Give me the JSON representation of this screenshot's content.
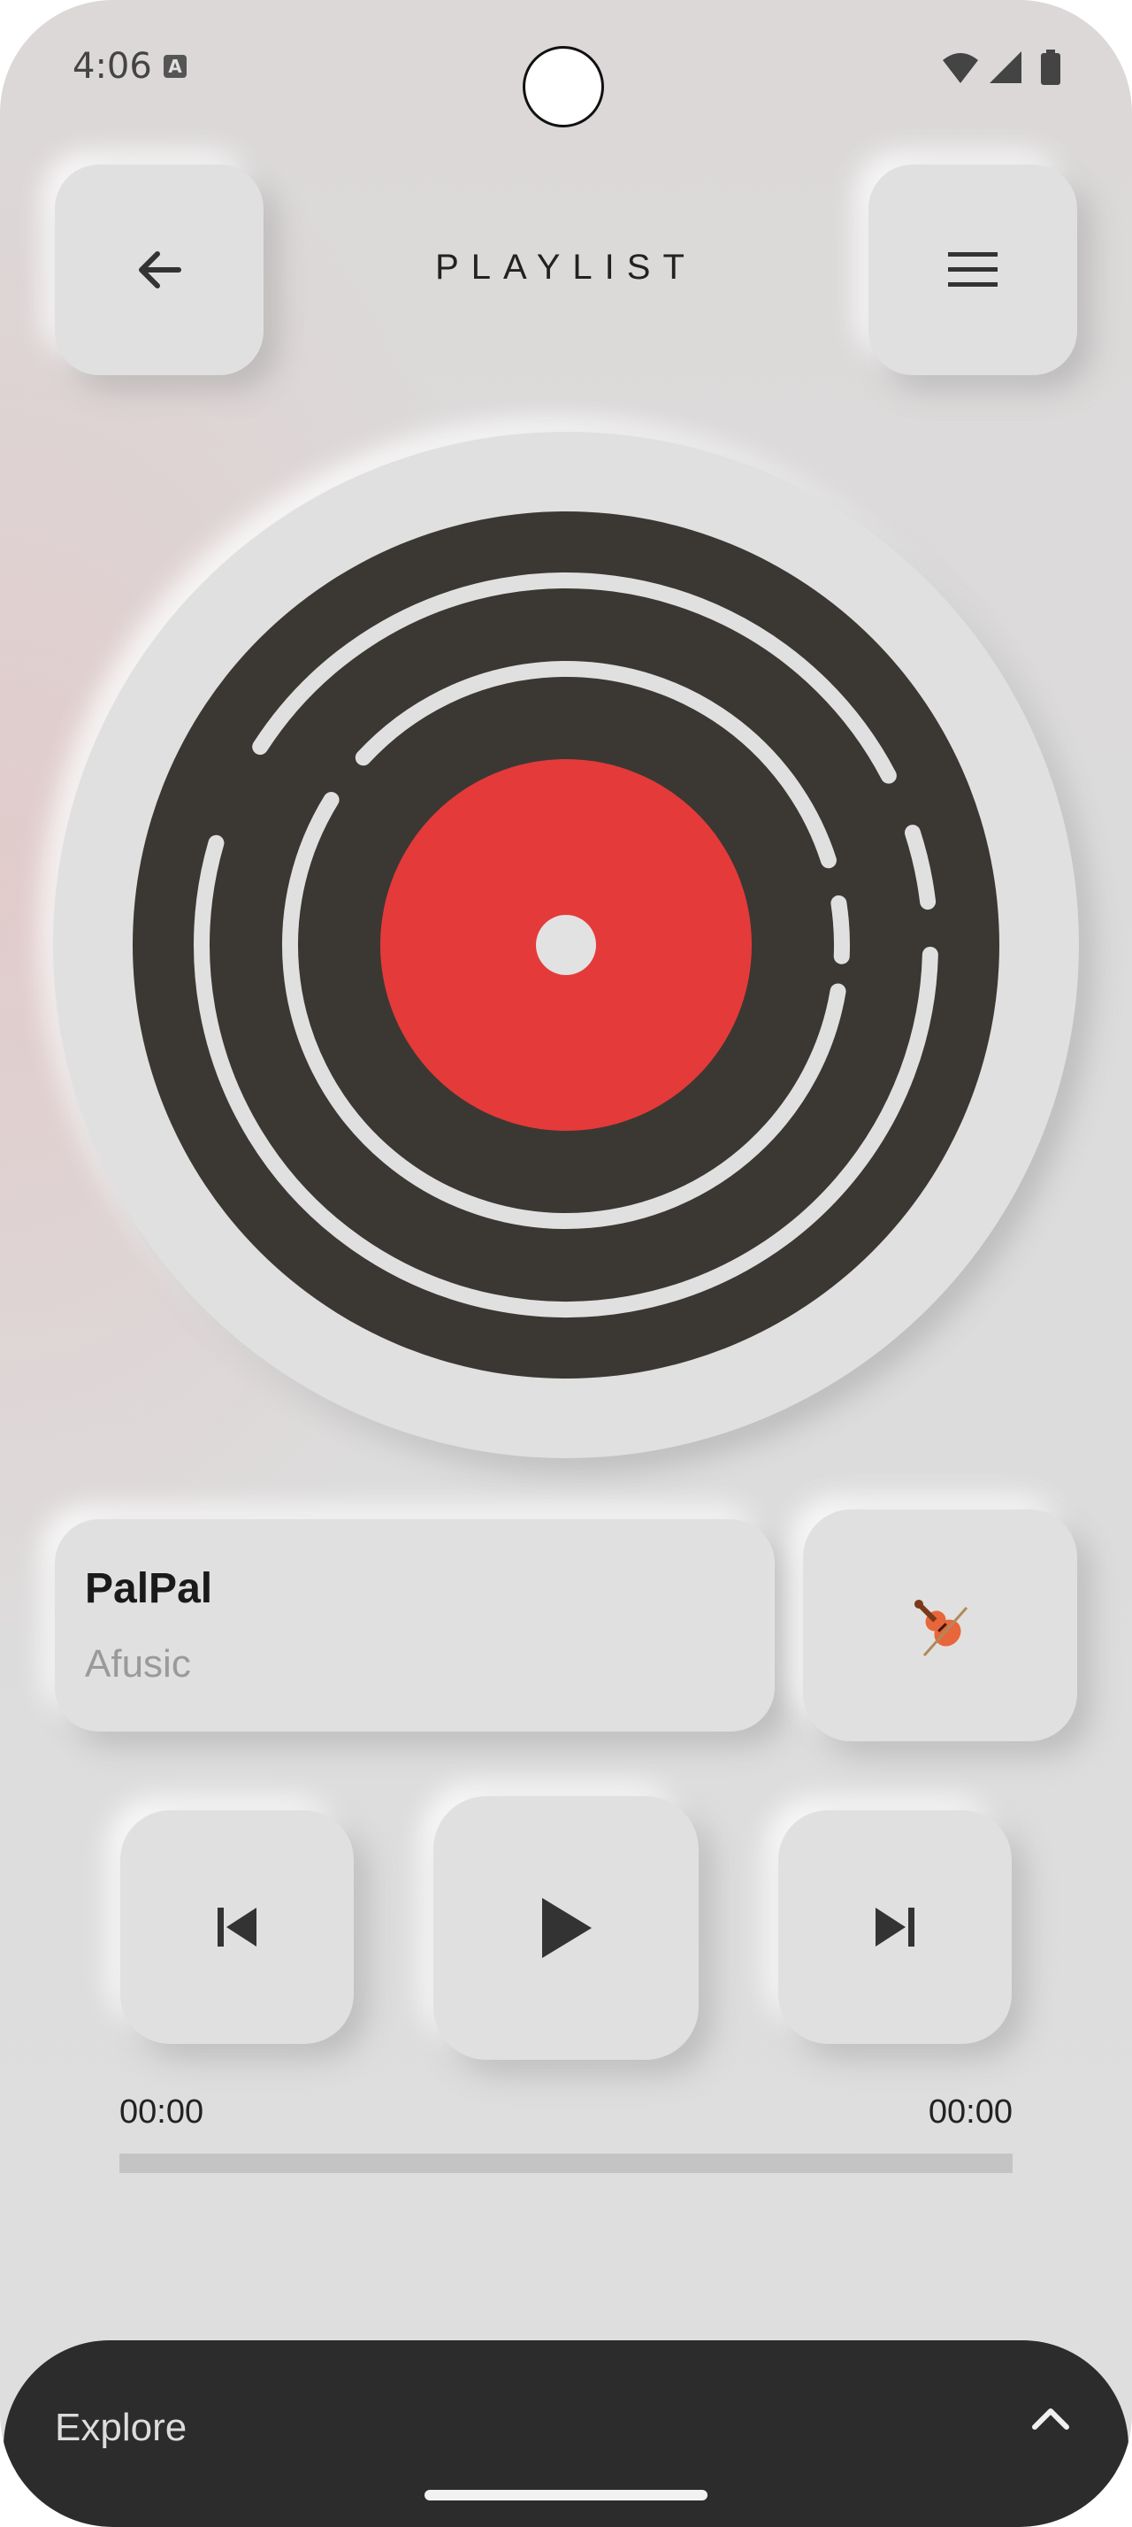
{
  "status_bar": {
    "time": "4:06",
    "notification_icon": "a-badge-icon",
    "icons": [
      "wifi-icon",
      "signal-icon",
      "battery-icon"
    ]
  },
  "header": {
    "title": "PLAYLIST",
    "back_icon": "arrow-left-icon",
    "menu_icon": "hamburger-menu-icon"
  },
  "player": {
    "album_art": "vinyl-record-icon",
    "colors": {
      "vinyl": "#3b3833",
      "label": "#e53a3a",
      "grooves": "#e0e0e0"
    },
    "song_title": "PalPal",
    "artist": "Afusic",
    "genre_icon": "violin-icon",
    "controls": [
      "skip-previous-icon",
      "play-icon",
      "skip-next-icon"
    ],
    "elapsed": "00:00",
    "duration": "00:00",
    "progress": 0
  },
  "bottom_sheet": {
    "label": "Explore",
    "icon": "chevron-up-icon"
  },
  "colors": {
    "surface": "#e0e0e0",
    "sheet": "#2c2c2c",
    "text": "#222222"
  }
}
